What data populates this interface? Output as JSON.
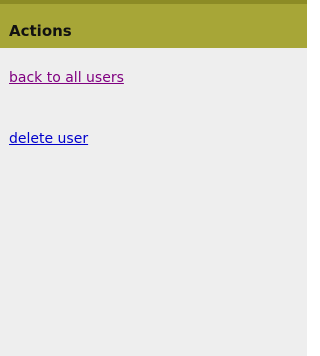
{
  "panel": {
    "title": "Actions",
    "links": {
      "back": {
        "label": "back to all users",
        "color": "#800080"
      },
      "delete": {
        "label": "delete user",
        "color": "#0000cc"
      }
    }
  }
}
